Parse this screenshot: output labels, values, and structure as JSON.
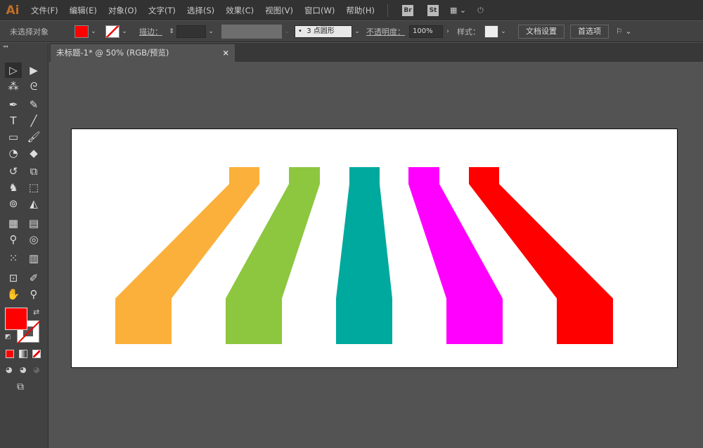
{
  "app": {
    "logo": "Ai"
  },
  "menu": [
    "文件(F)",
    "编辑(E)",
    "对象(O)",
    "文字(T)",
    "选择(S)",
    "效果(C)",
    "视图(V)",
    "窗口(W)",
    "帮助(H)"
  ],
  "menu_icons": {
    "bridge": "Br",
    "stock": "St"
  },
  "control": {
    "selection": "未选择对象",
    "fill_color": "#FF0000",
    "stroke_label": "描边：",
    "brush": "3 点圆形",
    "opacity_label": "不透明度：",
    "opacity": "100%",
    "style_label": "样式：",
    "doc_setup": "文档设置",
    "prefs": "首选项"
  },
  "tab": {
    "title": "未标题-1* @ 50% (RGB/预览)",
    "close": "×"
  },
  "shapes": {
    "colors": [
      "#FBB03B",
      "#8DC63F",
      "#00A99D",
      "#FF00FF",
      "#FF0000"
    ]
  }
}
